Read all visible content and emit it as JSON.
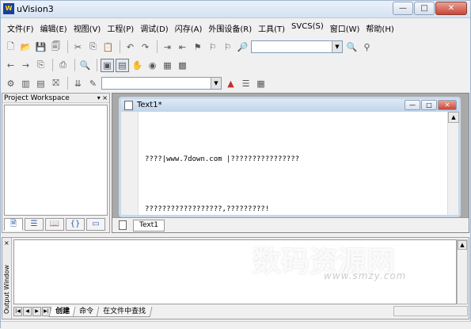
{
  "app": {
    "title": "uVision3",
    "icon_text": "W",
    "window_buttons": {
      "minimize": "—",
      "maximize": "□",
      "close": "✕"
    }
  },
  "menu": [
    "文件(F)",
    "编辑(E)",
    "视图(V)",
    "工程(P)",
    "调试(D)",
    "闪存(A)",
    "外围设备(R)",
    "工具(T)",
    "SVCS(S)",
    "窗口(W)",
    "帮助(H)"
  ],
  "toolbar1": {
    "find_combo_value": "",
    "icons": [
      "new-file-icon",
      "open-file-icon",
      "save-icon",
      "save-all-icon",
      "cut-icon",
      "copy-icon",
      "paste-icon",
      "undo-icon",
      "redo-icon",
      "indent-icon",
      "unindent-icon",
      "bookmark-toggle-icon",
      "bookmark-next-icon",
      "bookmark-prev-icon",
      "find-in-files-icon",
      "find-icon"
    ]
  },
  "toolbar2": {
    "icons": [
      "back-icon",
      "forward-icon",
      "goto-icon",
      "print-icon",
      "zoom-icon",
      "workspace-window-icon",
      "output-window-icon",
      "hand-icon",
      "watch-icon",
      "memory-icon",
      "disassembly-icon"
    ]
  },
  "toolbar3": {
    "target_combo_value": "",
    "icons": [
      "compile-icon",
      "build-icon",
      "rebuild-icon",
      "stop-build-icon",
      "download-icon",
      "options-icon",
      "target-icon",
      "group-icon",
      "manage-icon"
    ]
  },
  "workspace": {
    "title": "Project Workspace",
    "controls": "▾ ×",
    "tabs": [
      "files-tab-icon",
      "regs-tab-icon",
      "books-tab-icon",
      "functions-tab-icon",
      "templates-tab-icon"
    ]
  },
  "document": {
    "title": "Text1*",
    "lines": [
      "????|www.7down.com |????????????????",
      "??????????????????,?????????!"
    ],
    "tab_label": "Text1"
  },
  "output": {
    "side_label": "Output Window",
    "close": "×",
    "tabs": [
      "创建",
      "命令",
      "在文件中查找"
    ]
  },
  "watermark": {
    "logo": "数码资源网",
    "url": "www.smzy.com"
  }
}
